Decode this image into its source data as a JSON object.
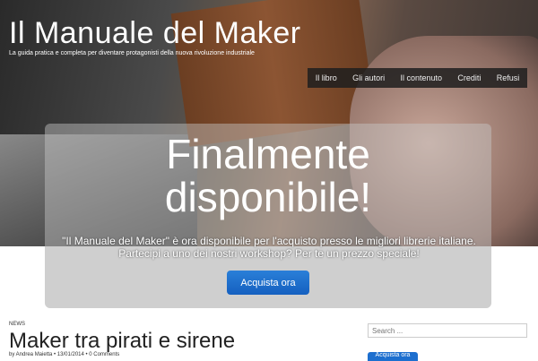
{
  "site": {
    "title": "Il Manuale del Maker",
    "tagline": "La guida pratica e completa per diventare protagonisti della nuova rivoluzione industriale"
  },
  "nav": {
    "items": [
      {
        "label": "Il libro"
      },
      {
        "label": "Gli autori"
      },
      {
        "label": "Il contenuto"
      },
      {
        "label": "Crediti"
      },
      {
        "label": "Refusi"
      }
    ]
  },
  "promo": {
    "headline_line1": "Finalmente",
    "headline_line2": "disponibile!",
    "text": "\"Il Manuale del Maker\" è ora disponibile per l'acquisto presso le migliori librerie italiane. Partecipi a uno dei nostri workshop? Per te un prezzo speciale!",
    "cta_label": "Acquista ora"
  },
  "post": {
    "category": "NEWS",
    "title": "Maker tra pirati e sirene",
    "meta": "by Andrea Maietta • 13/01/2014 • 0 Comments"
  },
  "sidebar": {
    "search_placeholder": "Search ...",
    "search_button": "Acquista ora"
  },
  "colors": {
    "nav_bg": "#1e1e1e",
    "cta": "#1d6fcf"
  }
}
